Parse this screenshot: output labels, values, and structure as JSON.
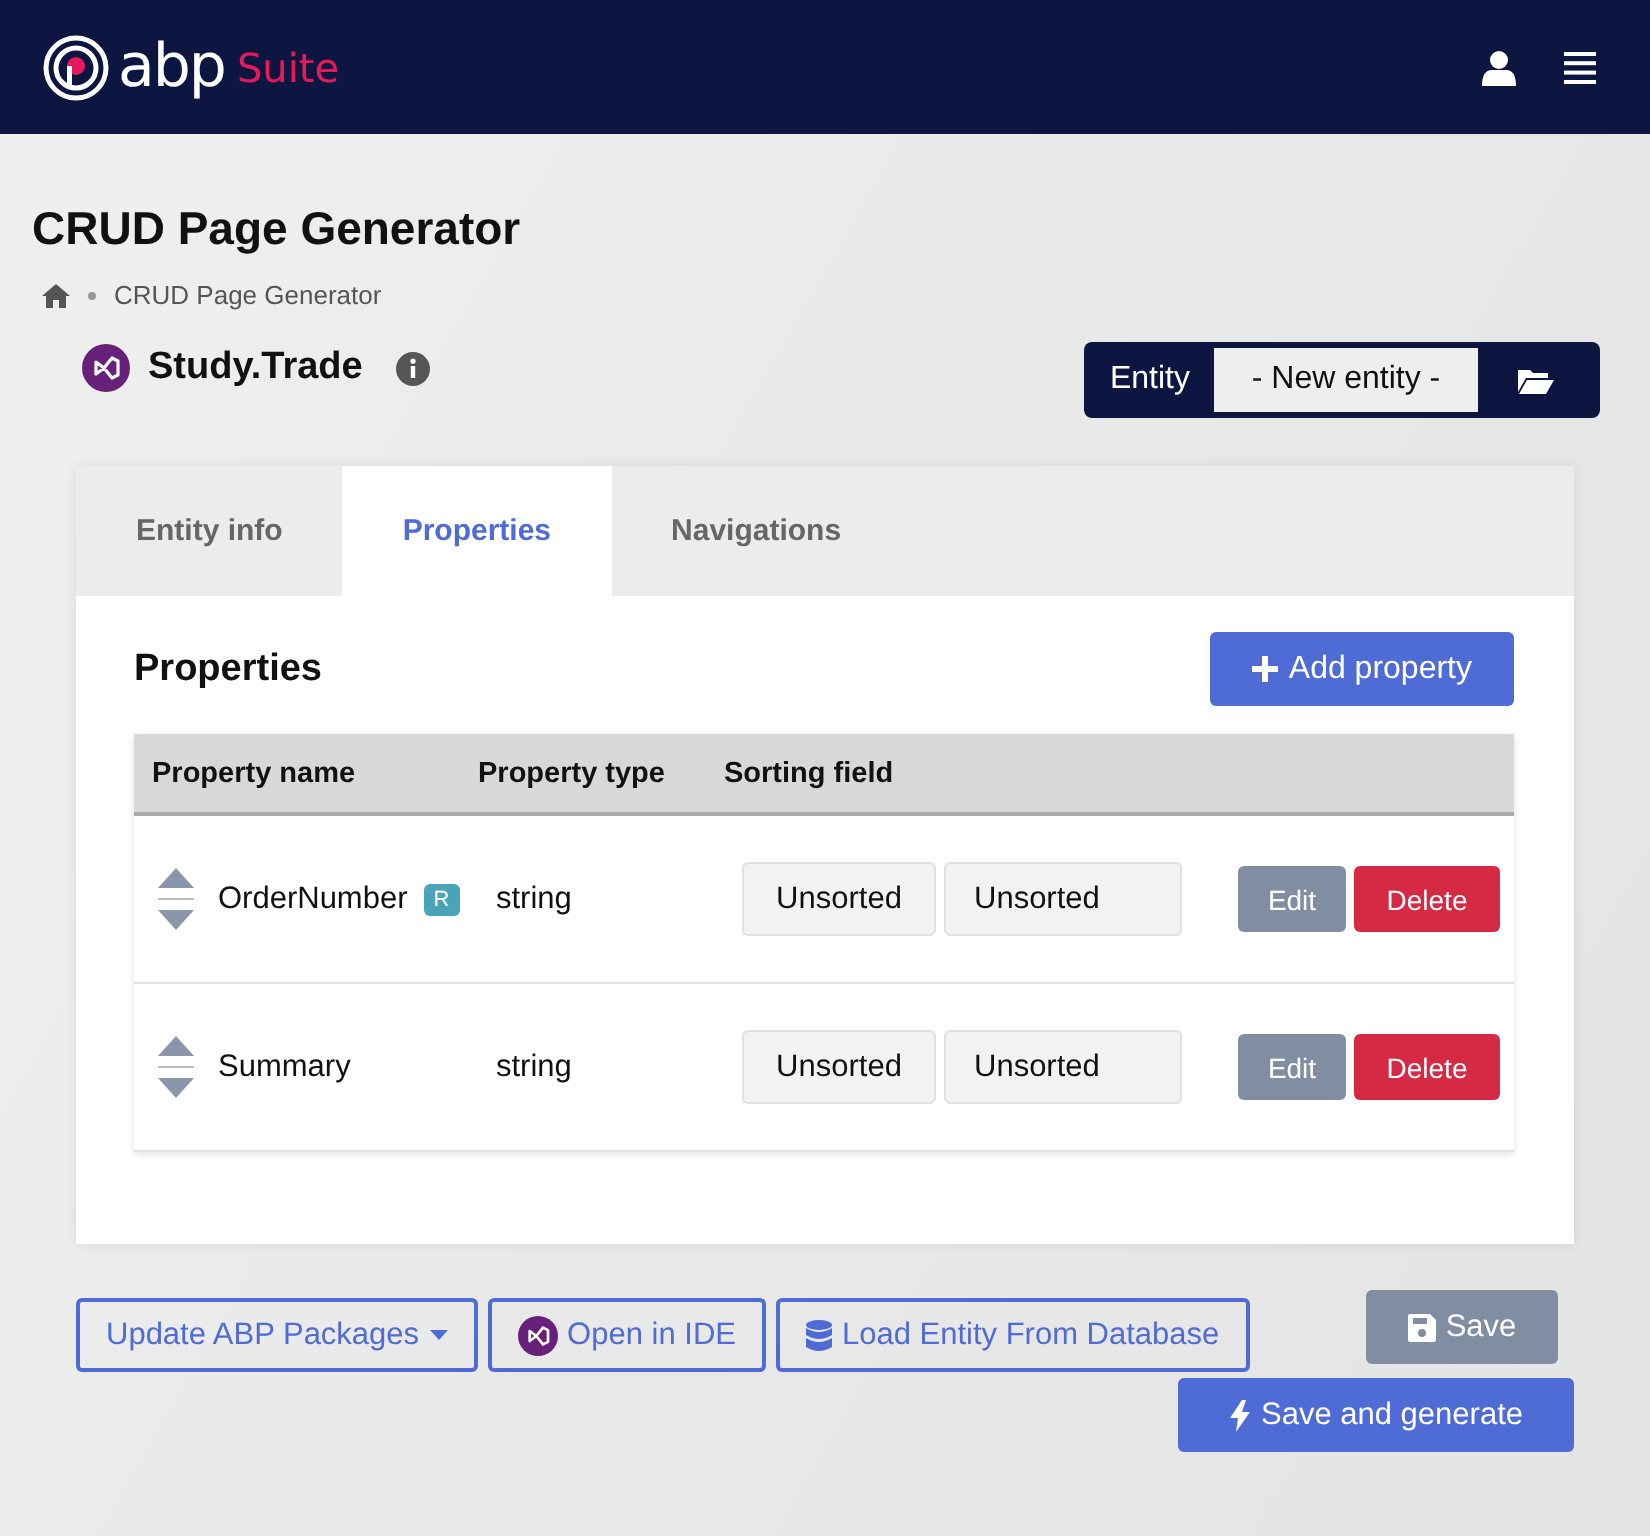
{
  "header": {
    "logo_text": "abp",
    "logo_suffix": "Suite"
  },
  "page_title": "CRUD Page Generator",
  "breadcrumb": [
    {
      "label": "CRUD Page Generator"
    }
  ],
  "project": {
    "name": "Study.Trade"
  },
  "entity_picker": {
    "label": "Entity",
    "value": "- New entity -"
  },
  "tabs": [
    {
      "label": "Entity info",
      "selected": false
    },
    {
      "label": "Properties",
      "selected": true
    },
    {
      "label": "Navigations",
      "selected": false
    }
  ],
  "properties": {
    "heading": "Properties",
    "add_button": "Add property",
    "columns": [
      "Property name",
      "Property type",
      "Sorting field"
    ],
    "rows": [
      {
        "name": "OrderNumber",
        "badge": "R",
        "type": "string",
        "sort_1": "Unsorted",
        "sort_2": "Unsorted",
        "edit": "Edit",
        "delete": "Delete"
      },
      {
        "name": "Summary",
        "type": "string",
        "sort_1": "Unsorted",
        "sort_2": "Unsorted",
        "edit": "Edit",
        "delete": "Delete"
      }
    ]
  },
  "footer_buttons": [
    {
      "label": "Update ABP Packages",
      "kind": "dropdown"
    },
    {
      "label": "Open in IDE",
      "kind": "ide"
    },
    {
      "label": "Load Entity From Database",
      "kind": "database"
    },
    {
      "label": "Save",
      "kind": "save"
    },
    {
      "label": "Save and generate",
      "kind": "generate"
    }
  ]
}
